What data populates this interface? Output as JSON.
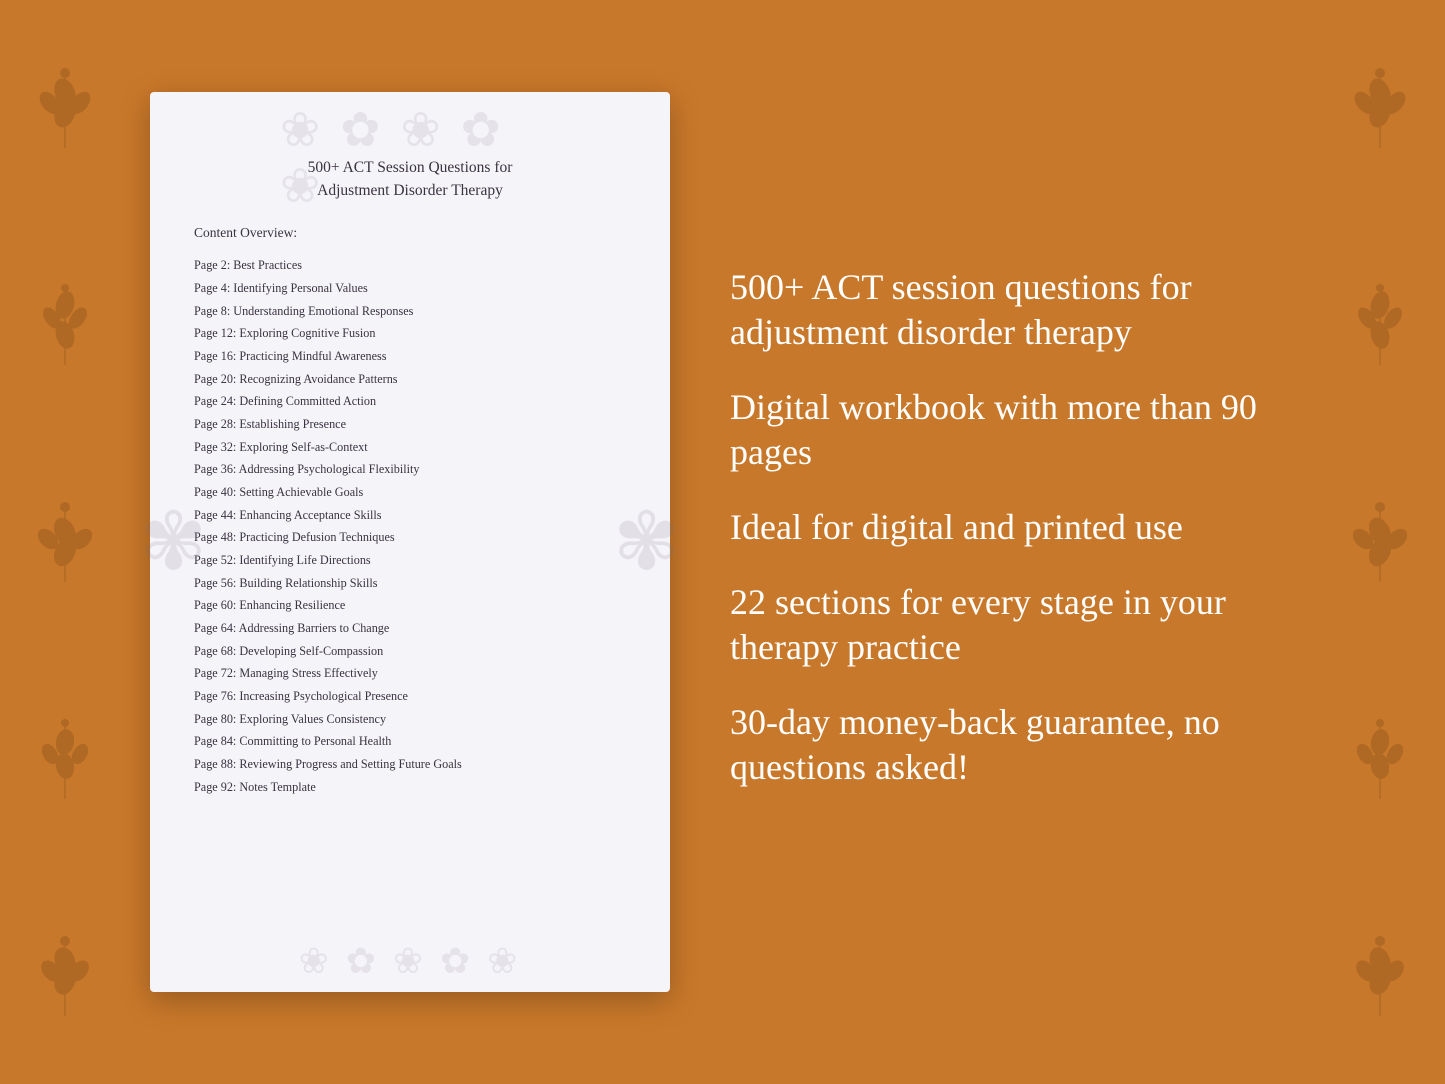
{
  "background": {
    "color": "#C8782A"
  },
  "document": {
    "title_line1": "500+ ACT Session Questions for",
    "title_line2": "Adjustment Disorder Therapy",
    "content_overview_label": "Content Overview:",
    "toc_items": [
      {
        "page": "Page  2:",
        "title": "Best Practices"
      },
      {
        "page": "Page  4:",
        "title": "Identifying Personal Values"
      },
      {
        "page": "Page  8:",
        "title": "Understanding Emotional Responses"
      },
      {
        "page": "Page 12:",
        "title": "Exploring Cognitive Fusion"
      },
      {
        "page": "Page 16:",
        "title": "Practicing Mindful Awareness"
      },
      {
        "page": "Page 20:",
        "title": "Recognizing Avoidance Patterns"
      },
      {
        "page": "Page 24:",
        "title": "Defining Committed Action"
      },
      {
        "page": "Page 28:",
        "title": "Establishing Presence"
      },
      {
        "page": "Page 32:",
        "title": "Exploring Self-as-Context"
      },
      {
        "page": "Page 36:",
        "title": "Addressing Psychological Flexibility"
      },
      {
        "page": "Page 40:",
        "title": "Setting Achievable Goals"
      },
      {
        "page": "Page 44:",
        "title": "Enhancing Acceptance Skills"
      },
      {
        "page": "Page 48:",
        "title": "Practicing Defusion Techniques"
      },
      {
        "page": "Page 52:",
        "title": "Identifying Life Directions"
      },
      {
        "page": "Page 56:",
        "title": "Building Relationship Skills"
      },
      {
        "page": "Page 60:",
        "title": "Enhancing Resilience"
      },
      {
        "page": "Page 64:",
        "title": "Addressing Barriers to Change"
      },
      {
        "page": "Page 68:",
        "title": "Developing Self-Compassion"
      },
      {
        "page": "Page 72:",
        "title": "Managing Stress Effectively"
      },
      {
        "page": "Page 76:",
        "title": "Increasing Psychological Presence"
      },
      {
        "page": "Page 80:",
        "title": "Exploring Values Consistency"
      },
      {
        "page": "Page 84:",
        "title": "Committing to Personal Health"
      },
      {
        "page": "Page 88:",
        "title": "Reviewing Progress and Setting Future Goals"
      },
      {
        "page": "Page 92:",
        "title": "Notes Template"
      }
    ]
  },
  "right_panel": {
    "features": [
      {
        "text": "500+ ACT session questions for adjustment disorder therapy"
      },
      {
        "text": "Digital workbook with more than 90 pages"
      },
      {
        "text": "Ideal for digital and printed use"
      },
      {
        "text": "22 sections for every stage in your therapy practice"
      },
      {
        "text": "30-day money-back guarantee, no questions asked!"
      }
    ]
  }
}
